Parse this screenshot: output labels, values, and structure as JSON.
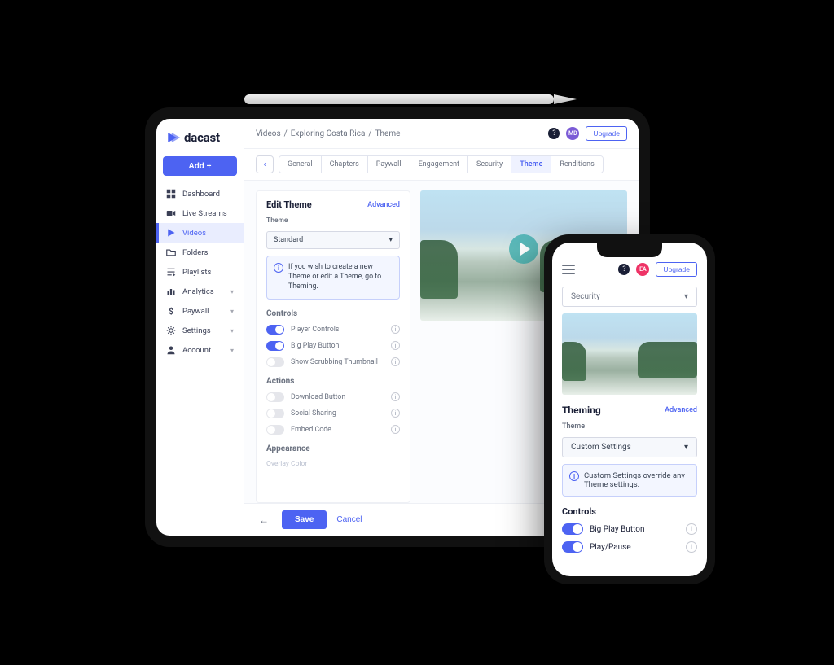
{
  "brand": {
    "name": "dacast"
  },
  "sidebar": {
    "add_label": "Add +",
    "items": [
      {
        "label": "Dashboard"
      },
      {
        "label": "Live Streams"
      },
      {
        "label": "Videos"
      },
      {
        "label": "Folders"
      },
      {
        "label": "Playlists"
      },
      {
        "label": "Analytics"
      },
      {
        "label": "Paywall"
      },
      {
        "label": "Settings"
      },
      {
        "label": "Account"
      }
    ]
  },
  "breadcrumb": {
    "a": "Videos",
    "b": "Exploring Costa Rica",
    "c": "Theme",
    "sep": "/"
  },
  "header": {
    "help": "?",
    "avatar": "MD",
    "upgrade": "Upgrade"
  },
  "tabs": {
    "back": "‹",
    "items": [
      "General",
      "Chapters",
      "Paywall",
      "Engagement",
      "Security",
      "Theme",
      "Renditions"
    ]
  },
  "panel": {
    "title": "Edit Theme",
    "advanced": "Advanced",
    "theme_label": "Theme",
    "theme_value": "Standard",
    "info": "If you wish to create a new Theme or edit a Theme, go to Theming.",
    "sections": {
      "controls": {
        "title": "Controls",
        "items": [
          {
            "label": "Player Controls",
            "on": true,
            "enabled": true
          },
          {
            "label": "Big Play Button",
            "on": true,
            "enabled": true
          },
          {
            "label": "Show Scrubbing Thumbnail",
            "on": false,
            "enabled": false
          }
        ]
      },
      "actions": {
        "title": "Actions",
        "items": [
          {
            "label": "Download Button",
            "on": false,
            "enabled": false
          },
          {
            "label": "Social Sharing",
            "on": false,
            "enabled": false
          },
          {
            "label": "Embed Code",
            "on": false,
            "enabled": false
          }
        ]
      },
      "appearance": {
        "title": "Appearance",
        "first_item": "Overlay Color"
      }
    }
  },
  "footer": {
    "save": "Save",
    "cancel": "Cancel"
  },
  "phone": {
    "avatar": "EA",
    "upgrade": "Upgrade",
    "help": "?",
    "tab_value": "Security",
    "theming_title": "Theming",
    "advanced": "Advanced",
    "theme_label": "Theme",
    "theme_value": "Custom Settings",
    "info": "Custom Settings override any Theme settings.",
    "controls_title": "Controls",
    "controls": [
      {
        "label": "Big Play Button",
        "on": true
      },
      {
        "label": "Play/Pause",
        "on": true
      }
    ]
  },
  "glyphs": {
    "chev_down": "▾",
    "hint": "i",
    "arrow_left": "←"
  }
}
